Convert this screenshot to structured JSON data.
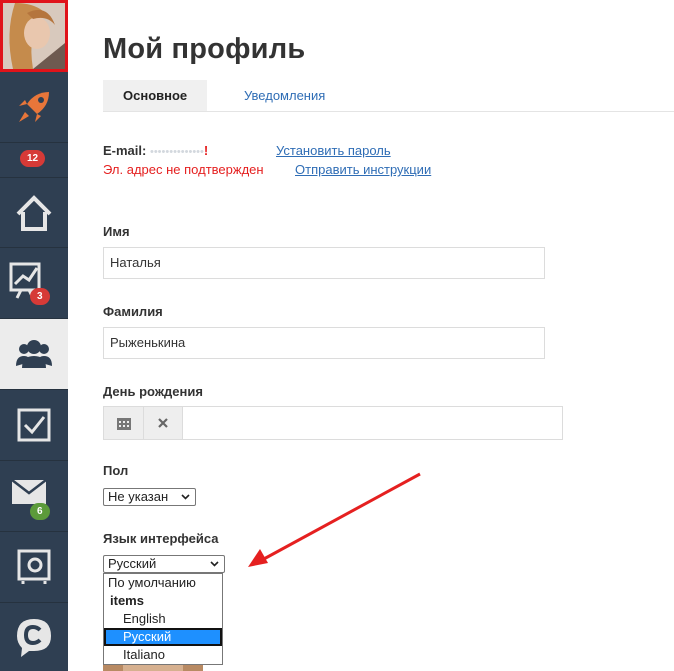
{
  "sidebar": {
    "badges": {
      "rocket": "12",
      "chart": "3",
      "mail": "6"
    },
    "colors": {
      "bg": "#2f3f52",
      "active_bg": "#ececec",
      "avatar_border": "#e0131a",
      "rocket": "#e8763a",
      "badge_red": "#d63a37",
      "badge_green": "#5c9b3a"
    }
  },
  "page": {
    "title": "Мой профиль",
    "tabs": [
      {
        "label": "Основное",
        "active": true
      },
      {
        "label": "Уведомления",
        "active": false
      }
    ]
  },
  "email": {
    "label": "E-mail:",
    "value": "••••••••••••••",
    "warning_mark": "!",
    "set_password": "Установить пароль",
    "not_confirmed": "Эл. адрес не подтвержден",
    "send_instructions": "Отправить инструкции"
  },
  "form": {
    "first_name": {
      "label": "Имя",
      "value": "Наталья"
    },
    "last_name": {
      "label": "Фамилия",
      "value": "Рыженькина"
    },
    "birthday": {
      "label": "День рождения",
      "value": ""
    },
    "gender": {
      "label": "Пол",
      "value": "Не указан"
    },
    "language": {
      "label": "Язык интерфейса",
      "value": "Русский",
      "options": [
        {
          "label": "По умолчанию",
          "type": "option"
        },
        {
          "label": "items",
          "type": "group"
        },
        {
          "label": "English",
          "type": "option",
          "indent": true
        },
        {
          "label": "Русский",
          "type": "option",
          "indent": true,
          "selected": true
        },
        {
          "label": "Italiano",
          "type": "option",
          "indent": true
        }
      ]
    }
  },
  "annotation": {
    "color": "#e52020"
  }
}
